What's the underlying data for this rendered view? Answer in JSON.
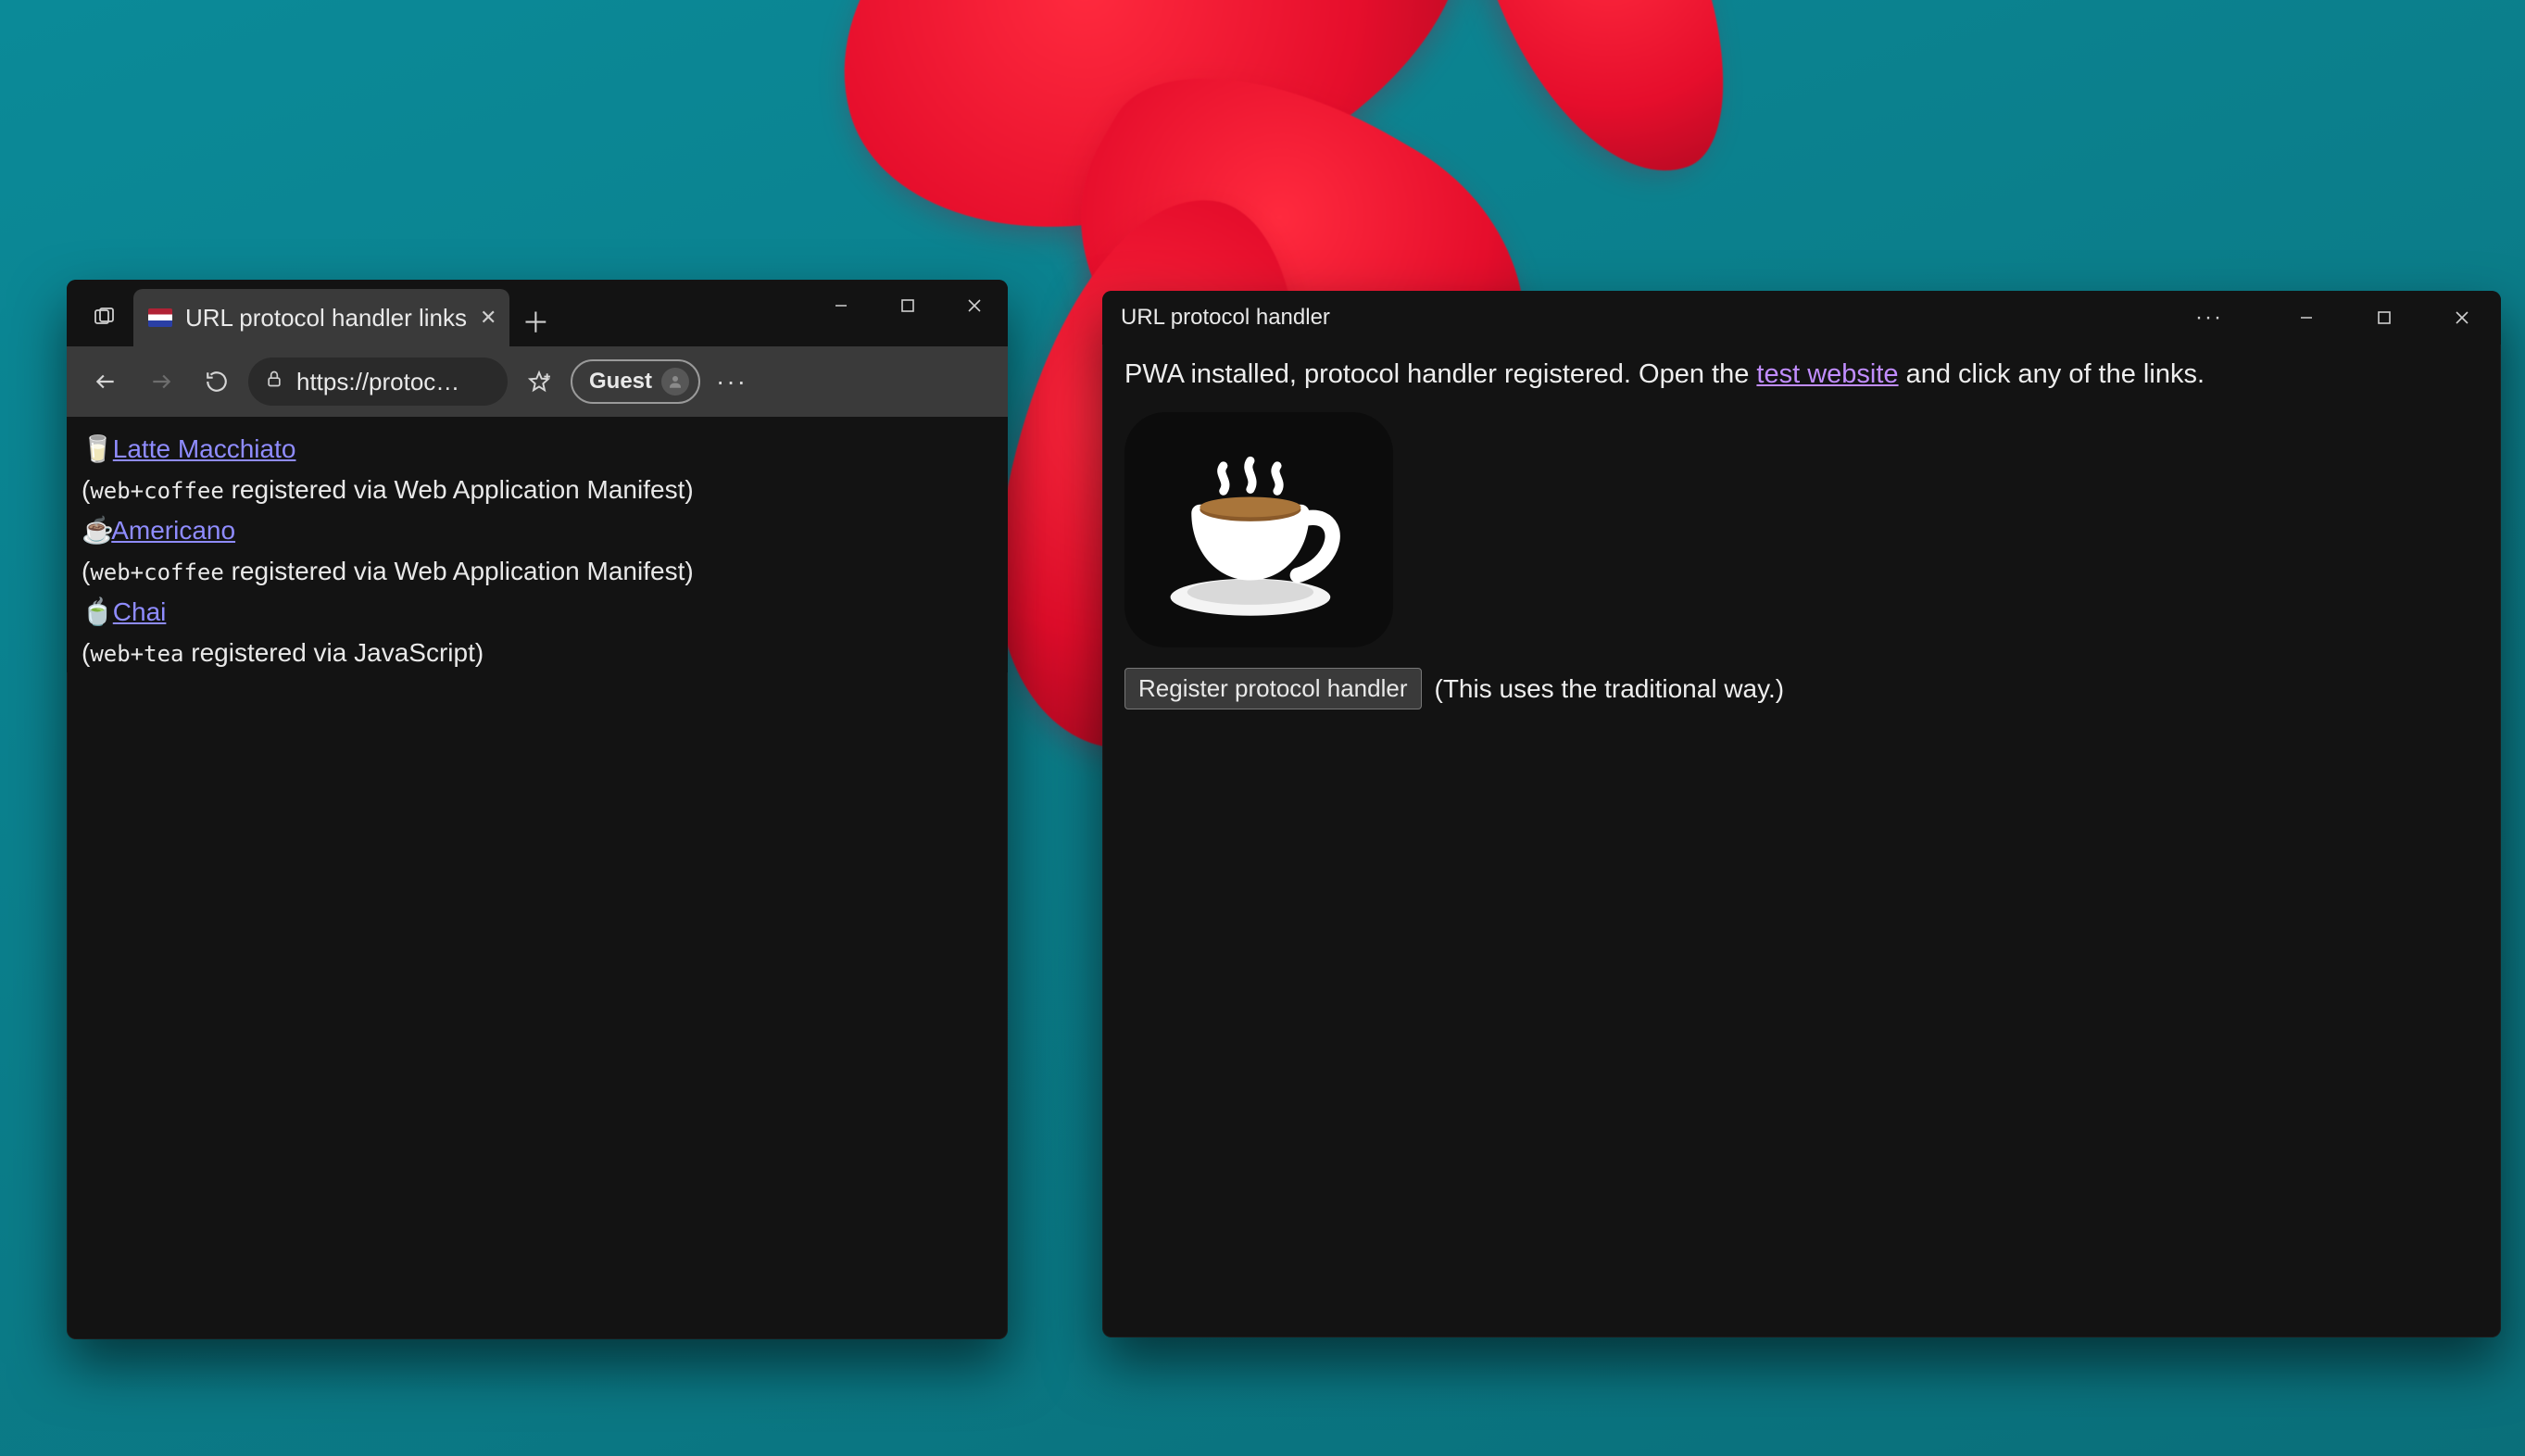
{
  "browser": {
    "tab_title": "URL protocol handler links",
    "address": "https://protoc…",
    "guest_label": "Guest",
    "links": [
      {
        "emoji": "🥛",
        "text": "Latte Macchiato",
        "note_prefix": "(",
        "code": "web+coffee",
        "note_suffix": " registered via Web Application Manifest)"
      },
      {
        "emoji": "☕",
        "text": "Americano",
        "note_prefix": "(",
        "code": "web+coffee",
        "note_suffix": " registered via Web Application Manifest)"
      },
      {
        "emoji": "🍵",
        "text": "Chai",
        "note_prefix": "(",
        "code": "web+tea",
        "note_suffix": " registered via JavaScript)"
      }
    ]
  },
  "pwa": {
    "title": "URL protocol handler",
    "line_prefix": "PWA installed, protocol handler registered. Open the ",
    "link_text": "test website",
    "line_suffix": " and click any of the links.",
    "button_label": "Register protocol handler",
    "button_note": "(This uses the traditional way.)"
  }
}
